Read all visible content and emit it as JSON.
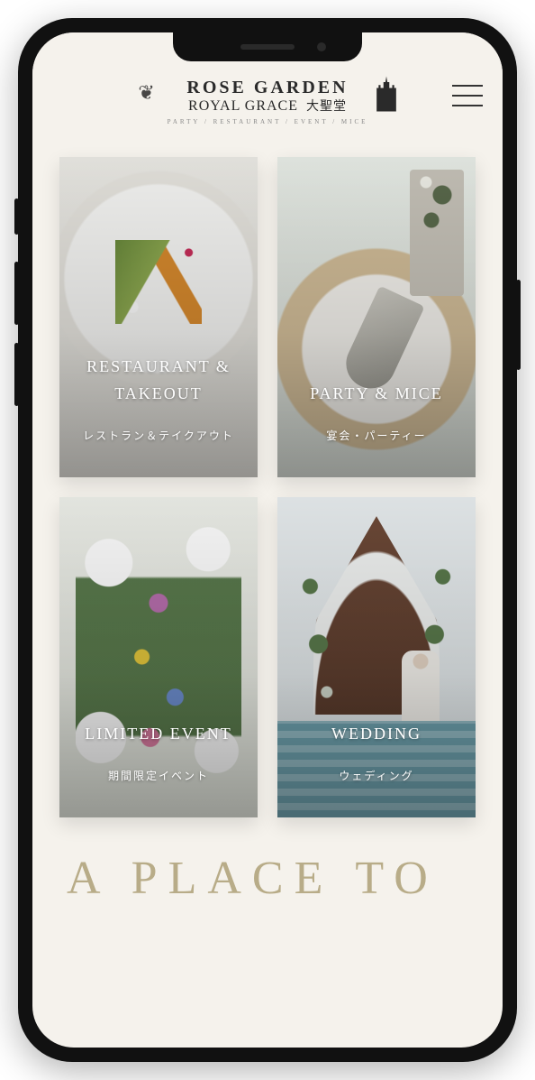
{
  "header": {
    "logo_line1": "ROSE GARDEN",
    "logo_line2": "ROYAL GRACE",
    "logo_line2_jp": "大聖堂",
    "logo_sub": "PARTY / RESTAURANT / EVENT / MICE"
  },
  "cards": [
    {
      "title_en": "RESTAURANT & TAKEOUT",
      "title_jp": "レストラン＆テイクアウト"
    },
    {
      "title_en": "PARTY & MICE",
      "title_jp": "宴会・パーティー"
    },
    {
      "title_en": "LIMITED EVENT",
      "title_jp": "期間限定イベント"
    },
    {
      "title_en": "WEDDING",
      "title_jp": "ウェディング"
    }
  ],
  "hero": {
    "line1": "A PLACE TO"
  }
}
